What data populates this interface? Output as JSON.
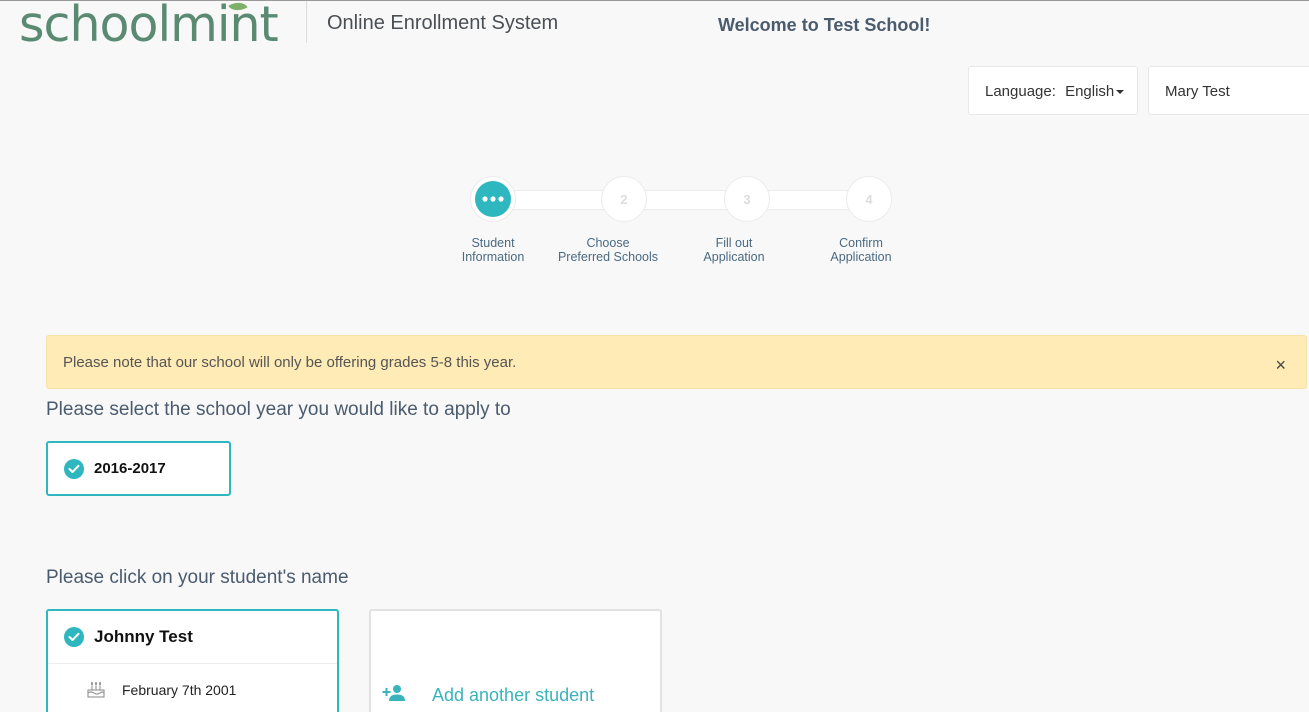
{
  "header": {
    "logo_text": "schoolmint",
    "system_title": "Online Enrollment System",
    "welcome": "Welcome to Test School!",
    "language_label": "Language:",
    "language_value": "English",
    "user_name": "Mary Test"
  },
  "stepper": {
    "steps": [
      {
        "number": "",
        "line1": "Student",
        "line2": "Information",
        "active": true
      },
      {
        "number": "2",
        "line1": "Choose",
        "line2": "Preferred Schools",
        "active": false
      },
      {
        "number": "3",
        "line1": "Fill out",
        "line2": "Application",
        "active": false
      },
      {
        "number": "4",
        "line1": "Confirm",
        "line2": "Application",
        "active": false
      }
    ]
  },
  "alert": {
    "message": "Please note that our school will only be offering grades 5-8 this year.",
    "close": "×"
  },
  "school_year": {
    "heading": "Please select the school year you would like to apply to",
    "selected": "2016-2017"
  },
  "students": {
    "heading": "Please click on your student's name",
    "list": [
      {
        "name": "Johnny Test",
        "dob": "February 7th 2001"
      }
    ],
    "add_label": "Add another student"
  },
  "colors": {
    "accent": "#2fb7c0",
    "logo": "#5a8a72",
    "alert_bg": "#feebb5"
  }
}
